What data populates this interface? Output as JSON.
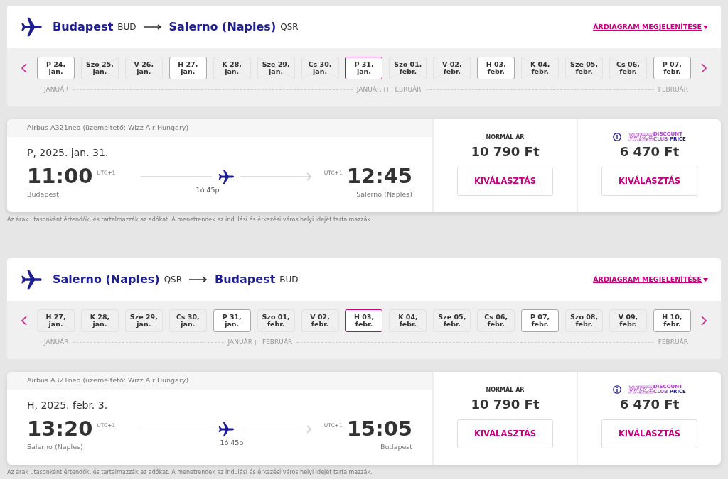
{
  "sections": [
    {
      "origin": {
        "city": "Budapest",
        "code": "BUD"
      },
      "destination": {
        "city": "Salerno (Naples)",
        "code": "QSR"
      },
      "chart_link": "ÁRDIAGRAM MEGJELENÍTÉSE",
      "months": [
        {
          "label_start": "JANUÁR",
          "label_end": "JANUÁR",
          "dates": [
            {
              "day": "P 24,",
              "month": "jan.",
              "available": true,
              "selected": false
            },
            {
              "day": "Szo 25,",
              "month": "jan.",
              "available": false,
              "selected": false
            },
            {
              "day": "V 26,",
              "month": "jan.",
              "available": false,
              "selected": false
            },
            {
              "day": "H 27,",
              "month": "jan.",
              "available": true,
              "selected": false
            },
            {
              "day": "K 28,",
              "month": "jan.",
              "available": false,
              "selected": false
            },
            {
              "day": "Sze 29,",
              "month": "jan.",
              "available": false,
              "selected": false
            },
            {
              "day": "Cs 30,",
              "month": "jan.",
              "available": false,
              "selected": false
            },
            {
              "day": "P 31,",
              "month": "jan.",
              "available": true,
              "selected": true
            }
          ]
        },
        {
          "label_start": "FEBRUÁR",
          "label_end": "FEBRUÁR",
          "dates": [
            {
              "day": "Szo 01,",
              "month": "febr.",
              "available": false,
              "selected": false
            },
            {
              "day": "V 02,",
              "month": "febr.",
              "available": false,
              "selected": false
            },
            {
              "day": "H 03,",
              "month": "febr.",
              "available": true,
              "selected": false
            },
            {
              "day": "K 04,",
              "month": "febr.",
              "available": false,
              "selected": false
            },
            {
              "day": "Sze 05,",
              "month": "febr.",
              "available": false,
              "selected": false
            },
            {
              "day": "Cs 06,",
              "month": "febr.",
              "available": false,
              "selected": false
            },
            {
              "day": "P 07,",
              "month": "febr.",
              "available": true,
              "selected": false
            }
          ]
        }
      ],
      "flight": {
        "aircraft": "Airbus A321neo (üzemeltető: Wizz Air Hungary)",
        "date": "P, 2025. jan. 31.",
        "dep_time": "11:00",
        "dep_tz": "UTC+1",
        "dep_city": "Budapest",
        "duration": "1ó 45p",
        "arr_tz": "UTC+1",
        "arr_time": "12:45",
        "arr_city": "Salerno (Naples)"
      },
      "normal": {
        "label": "NORMÁL ÁR",
        "price": "10 790 Ft",
        "button": "KIVÁLASZTÁS"
      },
      "club": {
        "logo_brand": "WIZZ",
        "logo_line1": "DISCOUNT",
        "logo_line2a": "CLUB",
        "logo_line2b": "PRICE",
        "price": "6 470 Ft",
        "button": "KIVÁLASZTÁS"
      },
      "note": "Az árak utasonként értendők, és tartalmazzák az adókat. A menetrendek az indulási és érkezési város helyi idejét tartalmazzák."
    },
    {
      "origin": {
        "city": "Salerno (Naples)",
        "code": "QSR"
      },
      "destination": {
        "city": "Budapest",
        "code": "BUD"
      },
      "chart_link": "ÁRDIAGRAM MEGJELENÍTÉSE",
      "months": [
        {
          "label_start": "JANUÁR",
          "label_end": "JANUÁR",
          "dates": [
            {
              "day": "H 27,",
              "month": "jan.",
              "available": false,
              "selected": false
            },
            {
              "day": "K 28,",
              "month": "jan.",
              "available": false,
              "selected": false
            },
            {
              "day": "Sze 29,",
              "month": "jan.",
              "available": false,
              "selected": false
            },
            {
              "day": "Cs 30,",
              "month": "jan.",
              "available": false,
              "selected": false
            },
            {
              "day": "P 31,",
              "month": "jan.",
              "available": true,
              "selected": false
            }
          ]
        },
        {
          "label_start": "FEBRUÁR",
          "label_end": "FEBRUÁR",
          "dates": [
            {
              "day": "Szo 01,",
              "month": "febr.",
              "available": false,
              "selected": false
            },
            {
              "day": "V 02,",
              "month": "febr.",
              "available": false,
              "selected": false
            },
            {
              "day": "H 03,",
              "month": "febr.",
              "available": true,
              "selected": true
            },
            {
              "day": "K 04,",
              "month": "febr.",
              "available": false,
              "selected": false
            },
            {
              "day": "Sze 05,",
              "month": "febr.",
              "available": false,
              "selected": false
            },
            {
              "day": "Cs 06,",
              "month": "febr.",
              "available": false,
              "selected": false
            },
            {
              "day": "P 07,",
              "month": "febr.",
              "available": true,
              "selected": false
            },
            {
              "day": "Szo 08,",
              "month": "febr.",
              "available": false,
              "selected": false
            },
            {
              "day": "V 09,",
              "month": "febr.",
              "available": false,
              "selected": false
            },
            {
              "day": "H 10,",
              "month": "febr.",
              "available": true,
              "selected": false
            }
          ]
        }
      ],
      "flight": {
        "aircraft": "Airbus A321neo (üzemeltető: Wizz Air Hungary)",
        "date": "H, 2025. febr. 3.",
        "dep_time": "13:20",
        "dep_tz": "UTC+1",
        "dep_city": "Salerno (Naples)",
        "duration": "1ó 45p",
        "arr_tz": "UTC+1",
        "arr_time": "15:05",
        "arr_city": "Budapest"
      },
      "normal": {
        "label": "NORMÁL ÁR",
        "price": "10 790 Ft",
        "button": "KIVÁLASZTÁS"
      },
      "club": {
        "logo_brand": "WIZZ",
        "logo_line1": "DISCOUNT",
        "logo_line2a": "CLUB",
        "logo_line2b": "PRICE",
        "price": "6 470 Ft",
        "button": "KIVÁLASZTÁS"
      },
      "note": "Az árak utasonként értendők, és tartalmazzák az adókat. A menetrendek az indulási és érkezési város helyi idejét tartalmazzák."
    }
  ]
}
